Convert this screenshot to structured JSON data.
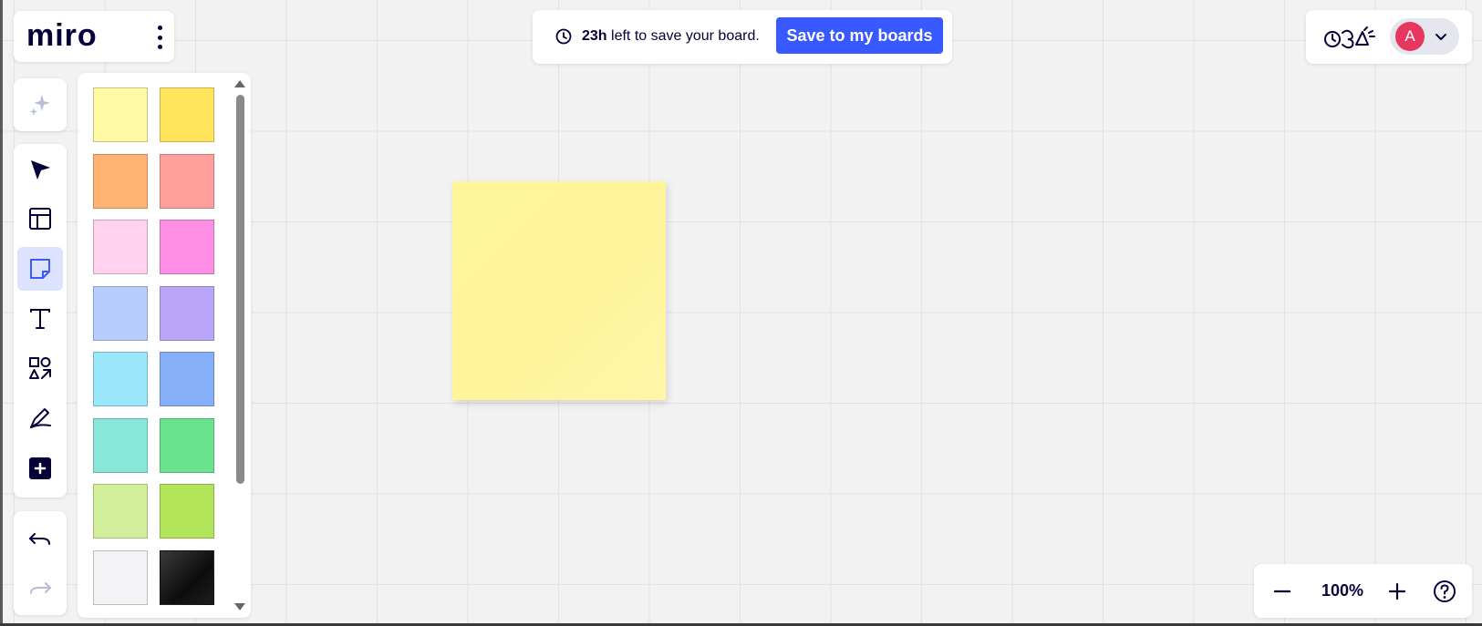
{
  "header": {
    "logo": "miro",
    "menu_icon": "more-vertical-icon"
  },
  "save_banner": {
    "time_left": "23h",
    "message": "left to save your board.",
    "button_label": "Save to my boards",
    "accent_color": "#3859ff"
  },
  "user": {
    "avatar_initial": "A",
    "avatar_color": "#e8375f"
  },
  "toolbar": {
    "ai_tool": "ai-sparkle-icon",
    "tools": [
      {
        "name": "select",
        "icon": "cursor-arrow-icon",
        "active": false
      },
      {
        "name": "templates",
        "icon": "template-layout-icon",
        "active": false
      },
      {
        "name": "sticky-note",
        "icon": "sticky-note-icon",
        "active": true
      },
      {
        "name": "text",
        "icon": "text-icon",
        "active": false
      },
      {
        "name": "shapes",
        "icon": "shapes-icon",
        "active": false
      },
      {
        "name": "pen",
        "icon": "pen-icon",
        "active": false
      },
      {
        "name": "more-tools",
        "icon": "plus-square-icon",
        "active": false
      }
    ],
    "undo_icon": "undo-icon",
    "redo_icon": "redo-icon"
  },
  "palette": {
    "colors": [
      [
        "#fff9a6",
        "#ffe45c"
      ],
      [
        "#ffb271",
        "#ff9e9a"
      ],
      [
        "#ffd2ee",
        "#ff8fe6"
      ],
      [
        "#b7cdfd",
        "#b9a6f8"
      ],
      [
        "#9be7fb",
        "#85aff8"
      ],
      [
        "#89e6da",
        "#6ae38f"
      ],
      [
        "#d2f09b",
        "#b2e55a"
      ],
      [
        "#f3f3f5",
        "#1a1a1a"
      ]
    ]
  },
  "canvas": {
    "sticky_color": "#fff59a"
  },
  "zoom": {
    "level": "100%",
    "out_icon": "minus-icon",
    "in_icon": "plus-icon",
    "help_icon": "help-circle-icon"
  }
}
